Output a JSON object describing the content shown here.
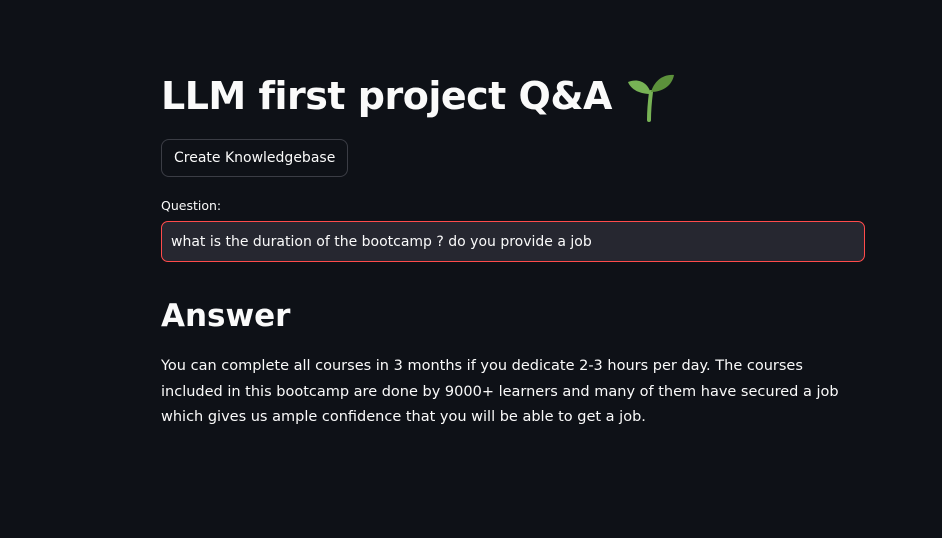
{
  "header": {
    "title": "LLM first project Q&A",
    "title_icon": "seedling-icon"
  },
  "actions": {
    "create_kb_label": "Create Knowledgebase"
  },
  "question": {
    "label": "Question:",
    "value": "what is the duration of the bootcamp ? do you provide a job"
  },
  "answer": {
    "heading": "Answer",
    "text": "You can complete all courses in 3 months if you dedicate 2-3 hours per day. The courses included in this bootcamp are done by 9000+ learners and many of them have secured a job which gives us ample confidence that you will be able to get a job."
  },
  "colors": {
    "background": "#0e1117",
    "text": "#fafafa",
    "input_background": "#262730",
    "focus_border": "#ff4b4b",
    "button_border": "#3b3d45"
  }
}
